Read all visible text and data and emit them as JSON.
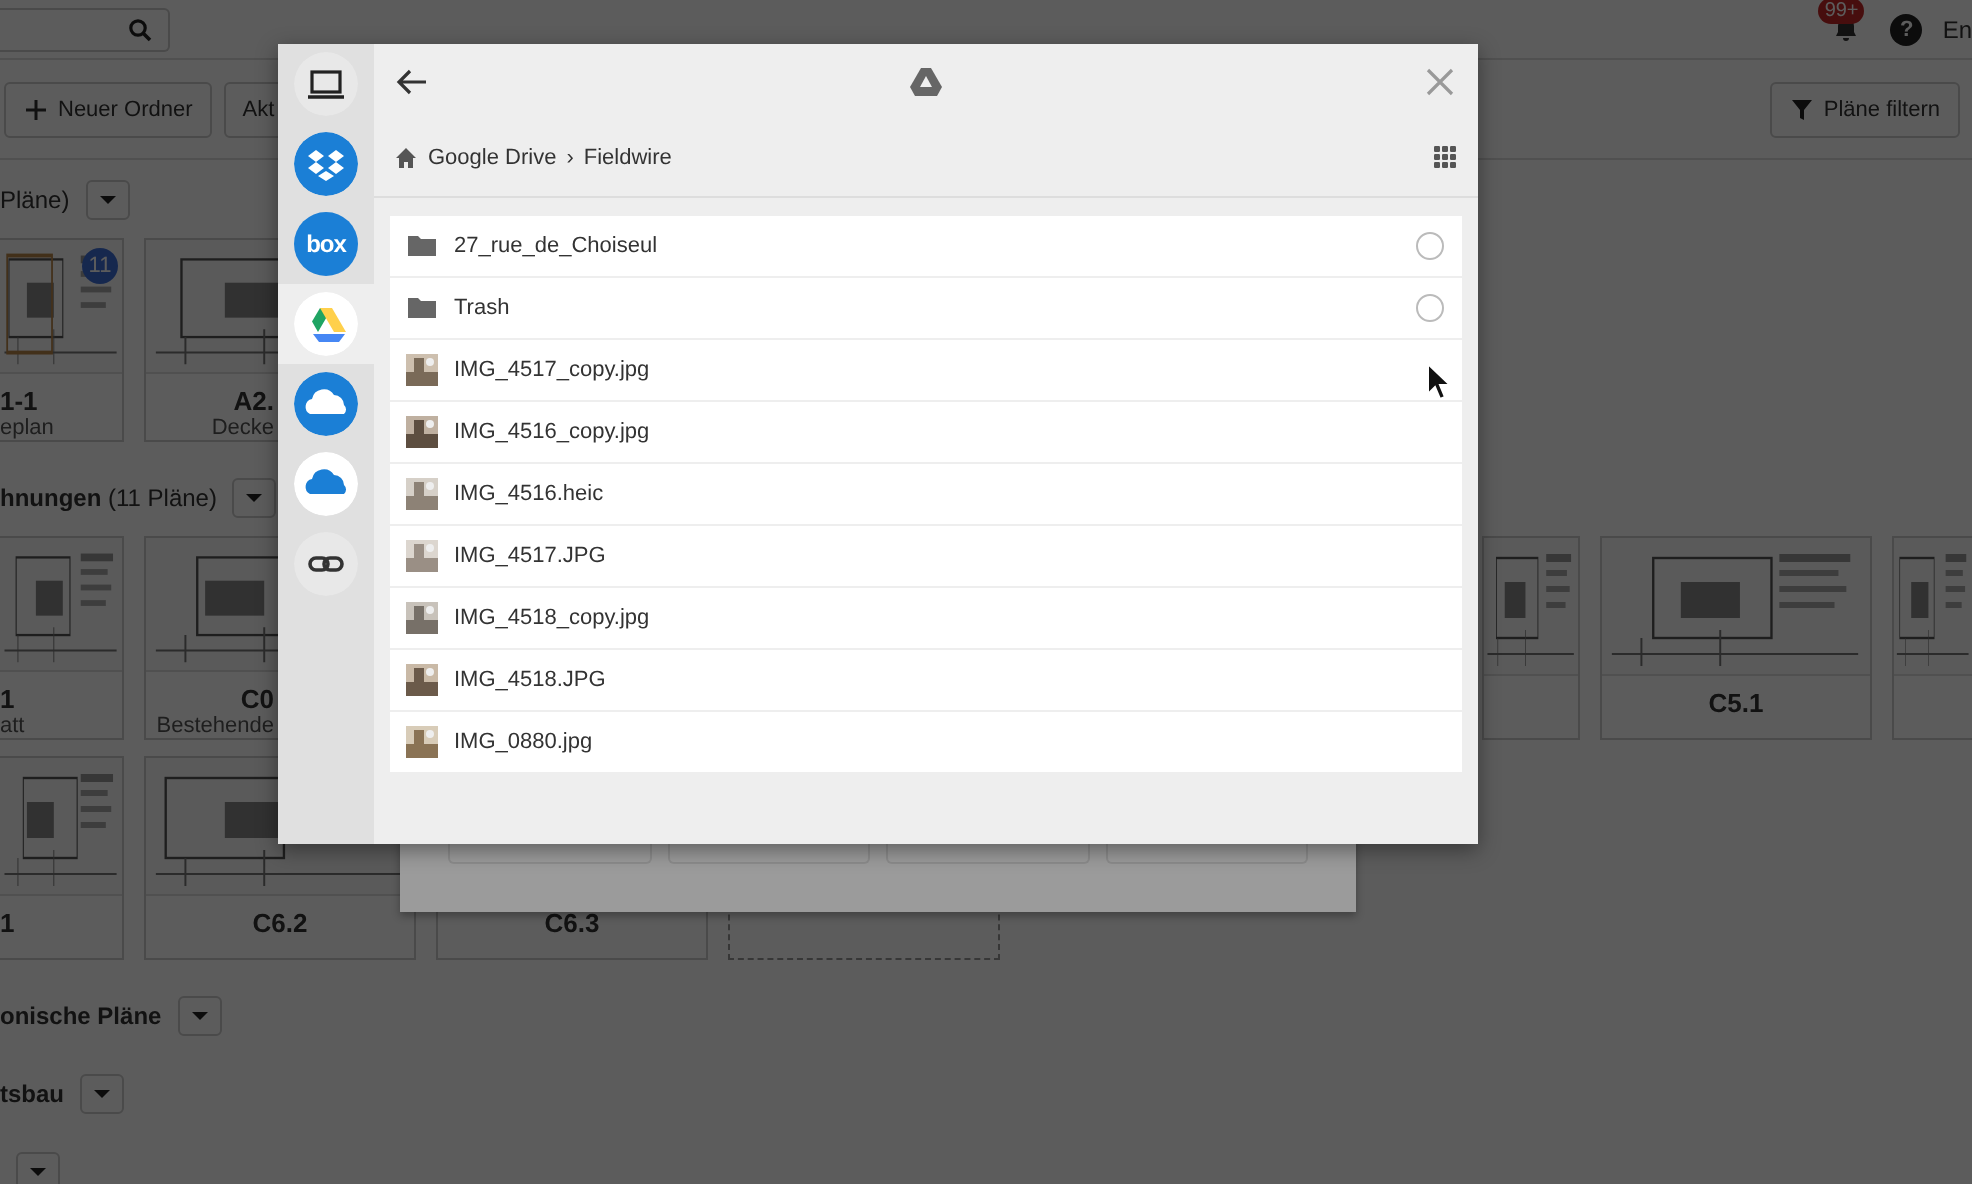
{
  "topbar": {
    "notification_badge": "99+",
    "help_label": "?",
    "user_label": "En"
  },
  "toolbar": {
    "buttons": [
      {
        "kind": "add",
        "label": "Neuer Ordner"
      },
      {
        "kind": "plain",
        "label": "Akt"
      }
    ],
    "filter_label": "Pläne filtern"
  },
  "sections": [
    {
      "count": "Pläne)",
      "dropdown": true,
      "rows": [
        [
          {
            "kind": "cut",
            "label": "1-1",
            "sub": "eplan",
            "badge": "11"
          },
          {
            "kind": "clipped",
            "label": "A2.",
            "sub": "Decke"
          }
        ]
      ]
    },
    {
      "title": "hnungen",
      "count": "(11 Pläne)",
      "dropdown": true,
      "rows": [
        [
          {
            "kind": "cut",
            "label": "1",
            "sub": "att"
          },
          {
            "kind": "clipped",
            "label": "C0",
            "sub": "Bestehende"
          },
          {
            "kind": "covered"
          },
          {
            "kind": "stub"
          },
          {
            "kind": "card",
            "label": "C5.1"
          },
          {
            "kind": "stub"
          }
        ],
        [
          {
            "kind": "cut",
            "label": "1"
          },
          {
            "kind": "card",
            "label": "C6.2"
          },
          {
            "kind": "label_only",
            "label": "C6.3"
          },
          {
            "kind": "empty"
          }
        ]
      ]
    },
    {
      "title": "onische Pläne",
      "dropdown": true
    },
    {
      "title": "tsbau",
      "dropdown": true
    },
    {
      "dropdown": true
    }
  ],
  "dialog": {
    "sources": [
      {
        "kind": "computer",
        "selected": false
      },
      {
        "kind": "dropbox",
        "selected": false
      },
      {
        "kind": "box",
        "logo_text": "box",
        "selected": false
      },
      {
        "kind": "google_drive",
        "selected": true
      },
      {
        "kind": "onedrive",
        "selected": false
      },
      {
        "kind": "onedrive_business",
        "selected": false
      },
      {
        "kind": "link",
        "selected": false
      }
    ],
    "breadcrumb": [
      "Google Drive",
      "Fieldwire"
    ],
    "separator": "›",
    "files": [
      {
        "kind": "folder",
        "name": "27_rue_de_Choiseul",
        "selected": false
      },
      {
        "kind": "folder",
        "name": "Trash",
        "selected": false
      },
      {
        "name": "IMG_4517_copy.jpg"
      },
      {
        "name": "IMG_4516_copy.jpg"
      },
      {
        "name": "IMG_4516.heic"
      },
      {
        "name": "IMG_4517.JPG"
      },
      {
        "name": "IMG_4518_copy.jpg"
      },
      {
        "name": "IMG_4518.JPG"
      },
      {
        "name": "IMG_0880.jpg"
      }
    ]
  }
}
